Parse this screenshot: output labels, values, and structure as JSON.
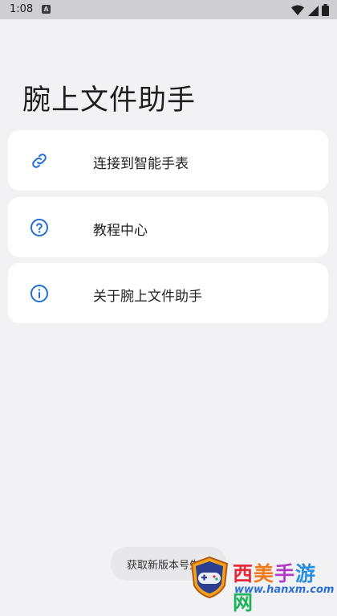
{
  "status_bar": {
    "time": "1:08",
    "notification_icon": "A"
  },
  "app": {
    "title": "腕上文件助手"
  },
  "menu": [
    {
      "label": "连接到智能手表",
      "icon": "link-icon"
    },
    {
      "label": "教程中心",
      "icon": "help-circle-icon"
    },
    {
      "label": "关于腕上文件助手",
      "icon": "info-circle-icon"
    }
  ],
  "toast": {
    "text": "获取新版本号失败"
  },
  "watermark": {
    "brand": "西美手游网",
    "url": "www.hanxm.com"
  },
  "colors": {
    "accent": "#1f6fd8",
    "background": "#f2f2f4",
    "card": "#ffffff"
  }
}
